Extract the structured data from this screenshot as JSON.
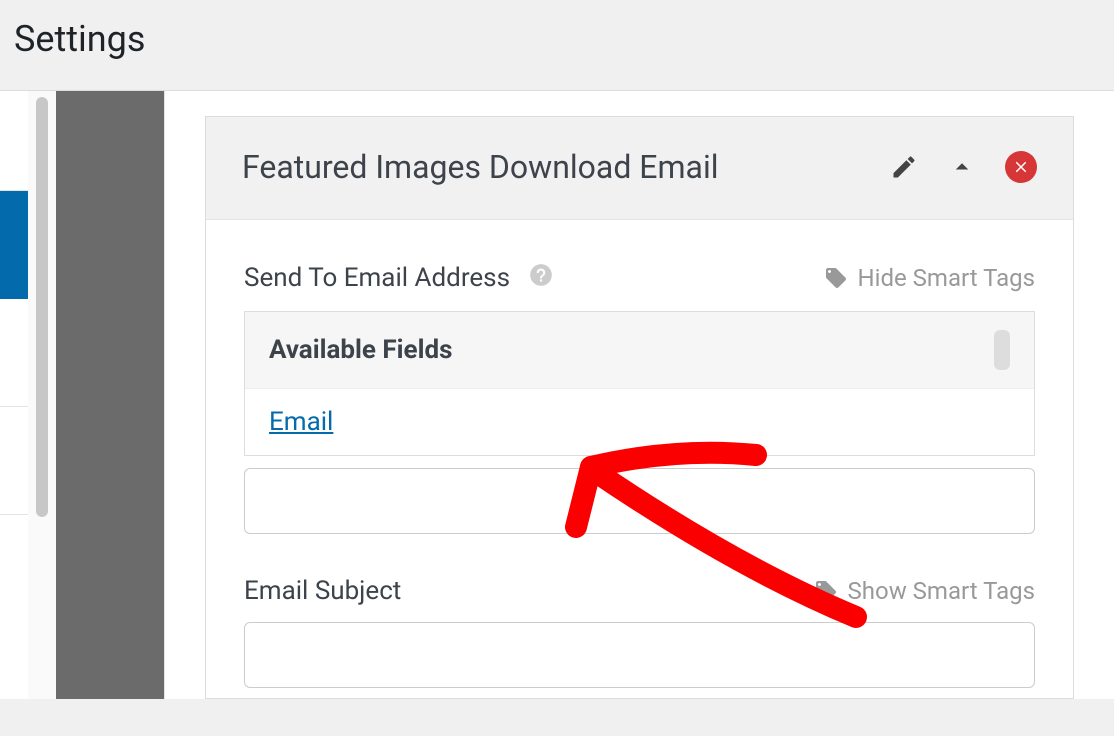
{
  "header": {
    "title": "Settings"
  },
  "panel": {
    "title": "Featured Images Download Email"
  },
  "section1": {
    "label": "Send To Email Address",
    "toggle": "Hide Smart Tags",
    "available_title": "Available Fields",
    "email_field": "Email"
  },
  "section2": {
    "label": "Email Subject",
    "toggle": "Show Smart Tags"
  }
}
